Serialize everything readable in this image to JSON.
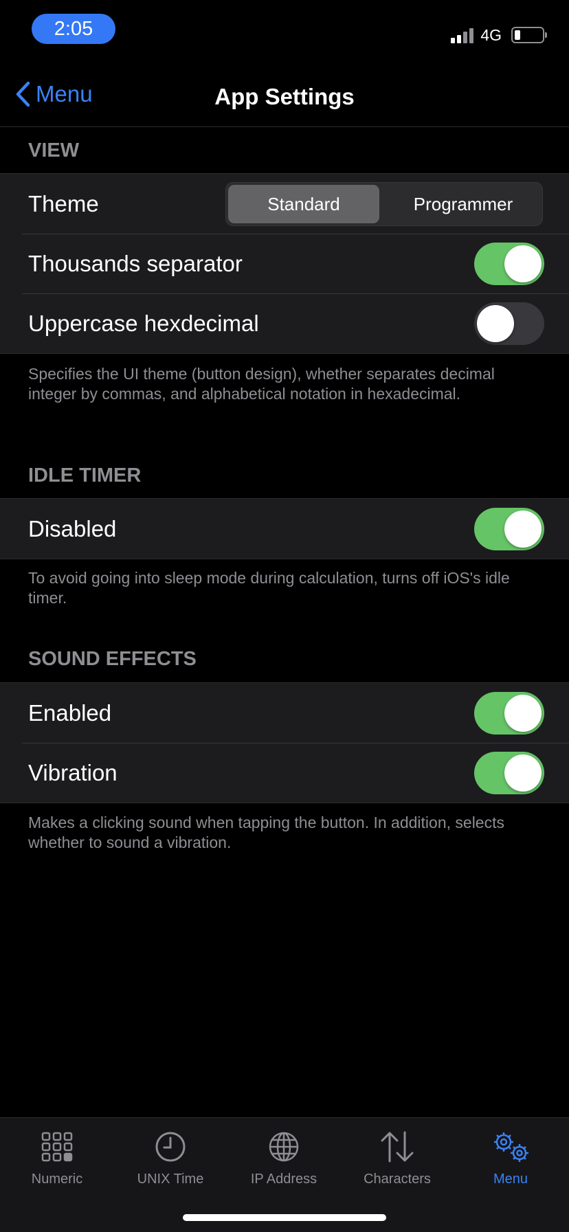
{
  "status": {
    "time": "2:05",
    "network": "4G"
  },
  "nav": {
    "back_label": "Menu",
    "title": "App Settings"
  },
  "view": {
    "header": "VIEW",
    "theme_label": "Theme",
    "theme_options": [
      "Standard",
      "Programmer"
    ],
    "theme_selected": "Standard",
    "thousands_label": "Thousands separator",
    "thousands_on": true,
    "upper_label": "Uppercase hexdecimal",
    "upper_on": false,
    "footer": "Specifies the UI theme (button design), whether separates decimal integer by commas, and alphabetical notation in hexadecimal."
  },
  "idle": {
    "header": "IDLE TIMER",
    "disabled_label": "Disabled",
    "disabled_on": true,
    "footer": "To avoid going into sleep mode during calculation, turns off iOS's idle timer."
  },
  "sound": {
    "header": "SOUND EFFECTS",
    "enabled_label": "Enabled",
    "enabled_on": true,
    "vibration_label": "Vibration",
    "vibration_on": true,
    "footer": "Makes a clicking sound when tapping the button. In addition, selects whether to sound a vibration."
  },
  "tabs": [
    {
      "label": "Numeric",
      "icon": "grid-icon"
    },
    {
      "label": "UNIX Time",
      "icon": "clock-icon"
    },
    {
      "label": "IP Address",
      "icon": "globe-icon"
    },
    {
      "label": "Characters",
      "icon": "arrows-icon"
    },
    {
      "label": "Menu",
      "icon": "gears-icon",
      "active": true
    }
  ],
  "colors": {
    "accent": "#3a82f7",
    "toggle_on": "#65c466",
    "toggle_off": "#39393d"
  }
}
